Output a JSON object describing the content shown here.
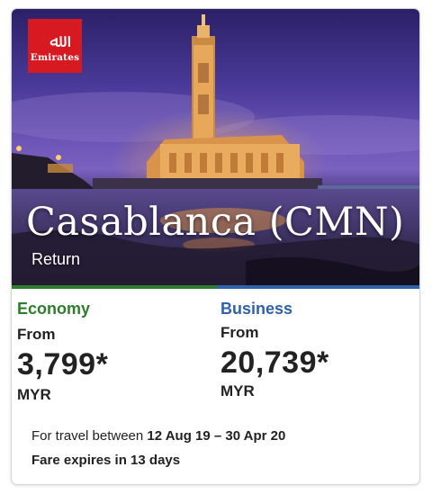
{
  "brand": {
    "logo_text": "Emirates",
    "logo_mark": "ﷲ",
    "color": "#d71a21"
  },
  "hero": {
    "city": "Casablanca (CMN)",
    "trip_type": "Return"
  },
  "fares": {
    "economy": {
      "cabin": "Economy",
      "from_label": "From",
      "price": "3,799*",
      "currency": "MYR",
      "color": "#2e7d2e"
    },
    "business": {
      "cabin": "Business",
      "from_label": "From",
      "price": "20,739*",
      "currency": "MYR",
      "color": "#2f62a8"
    }
  },
  "travel": {
    "prefix": "For travel between",
    "dates": "12 Aug 19 – 30 Apr 20"
  },
  "expiry": "Fare expires in 13 days"
}
